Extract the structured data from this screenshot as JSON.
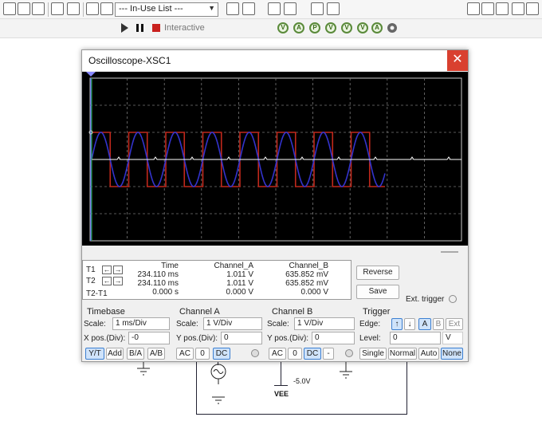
{
  "toolbar": {
    "combo_value": "--- In-Use List ---",
    "mode_label": "Interactive"
  },
  "scope_window": {
    "title": "Oscilloscope-XSC1",
    "close_glyph": "✕",
    "colors": {
      "channel_a": "#c0281c",
      "channel_b": "#3333cc",
      "trace_white": "#ffffff",
      "cursor_t1": "#3333ff",
      "cursor_t2": "#33cc33"
    },
    "measurements": {
      "headers": [
        "Time",
        "Channel_A",
        "Channel_B"
      ],
      "rows": [
        {
          "label": "T1",
          "time": "234.110 ms",
          "a": "1.011 V",
          "b": "635.852 mV"
        },
        {
          "label": "T2",
          "time": "234.110 ms",
          "a": "1.011 V",
          "b": "635.852 mV"
        },
        {
          "label": "T2-T1",
          "time": "0.000 s",
          "a": "0.000 V",
          "b": "0.000 V"
        }
      ]
    },
    "buttons": {
      "reverse": "Reverse",
      "save": "Save",
      "ext_trigger": "Ext. trigger"
    },
    "timebase": {
      "title": "Timebase",
      "scale_label": "Scale:",
      "scale_value": "1 ms/Div",
      "xpos_label": "X pos.(Div):",
      "xpos_value": "-0",
      "modes": [
        "Y/T",
        "Add",
        "B/A",
        "A/B"
      ]
    },
    "channel_a": {
      "title": "Channel A",
      "scale_label": "Scale:",
      "scale_value": "1  V/Div",
      "ypos_label": "Y pos.(Div):",
      "ypos_value": "0",
      "coupling": [
        "AC",
        "0",
        "DC"
      ]
    },
    "channel_b": {
      "title": "Channel B",
      "scale_label": "Scale:",
      "scale_value": "1  V/Div",
      "ypos_label": "Y pos.(Div):",
      "ypos_value": "0",
      "coupling": [
        "AC",
        "0",
        "DC",
        "-"
      ]
    },
    "trigger": {
      "title": "Trigger",
      "edge_label": "Edge:",
      "edge_options": [
        "↑",
        "↓",
        "A",
        "B",
        "Ext"
      ],
      "level_label": "Level:",
      "level_value": "0",
      "level_unit": "V",
      "modes": [
        "Single",
        "Normal",
        "Auto",
        "None"
      ]
    }
  },
  "schematic": {
    "vee_label": "VEE",
    "vee_value": "-5.0V"
  }
}
